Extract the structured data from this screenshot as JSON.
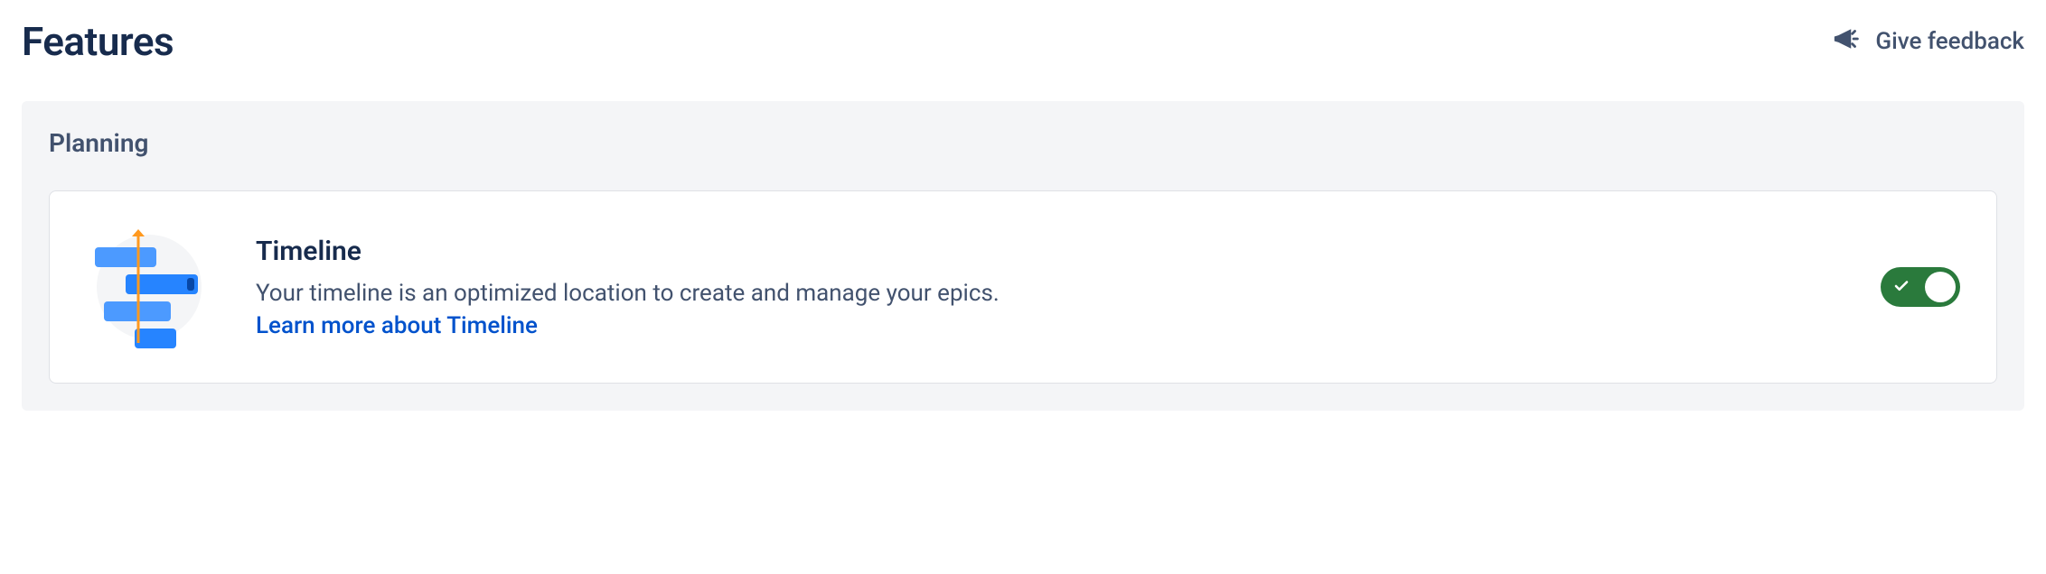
{
  "header": {
    "title": "Features",
    "feedback_label": "Give feedback"
  },
  "section": {
    "title": "Planning"
  },
  "feature": {
    "title": "Timeline",
    "description": "Your timeline is an optimized location to create and manage your epics.",
    "link_label": "Learn more about Timeline",
    "toggle_on": true
  },
  "icons": {
    "feedback": "megaphone-icon",
    "feature": "timeline-icon"
  },
  "colors": {
    "accent_green": "#2a7a3c",
    "link_blue": "#0052cc",
    "text_primary": "#172b4d",
    "text_secondary": "#42526e",
    "section_bg": "#f4f5f7",
    "border": "#dfe1e6"
  }
}
